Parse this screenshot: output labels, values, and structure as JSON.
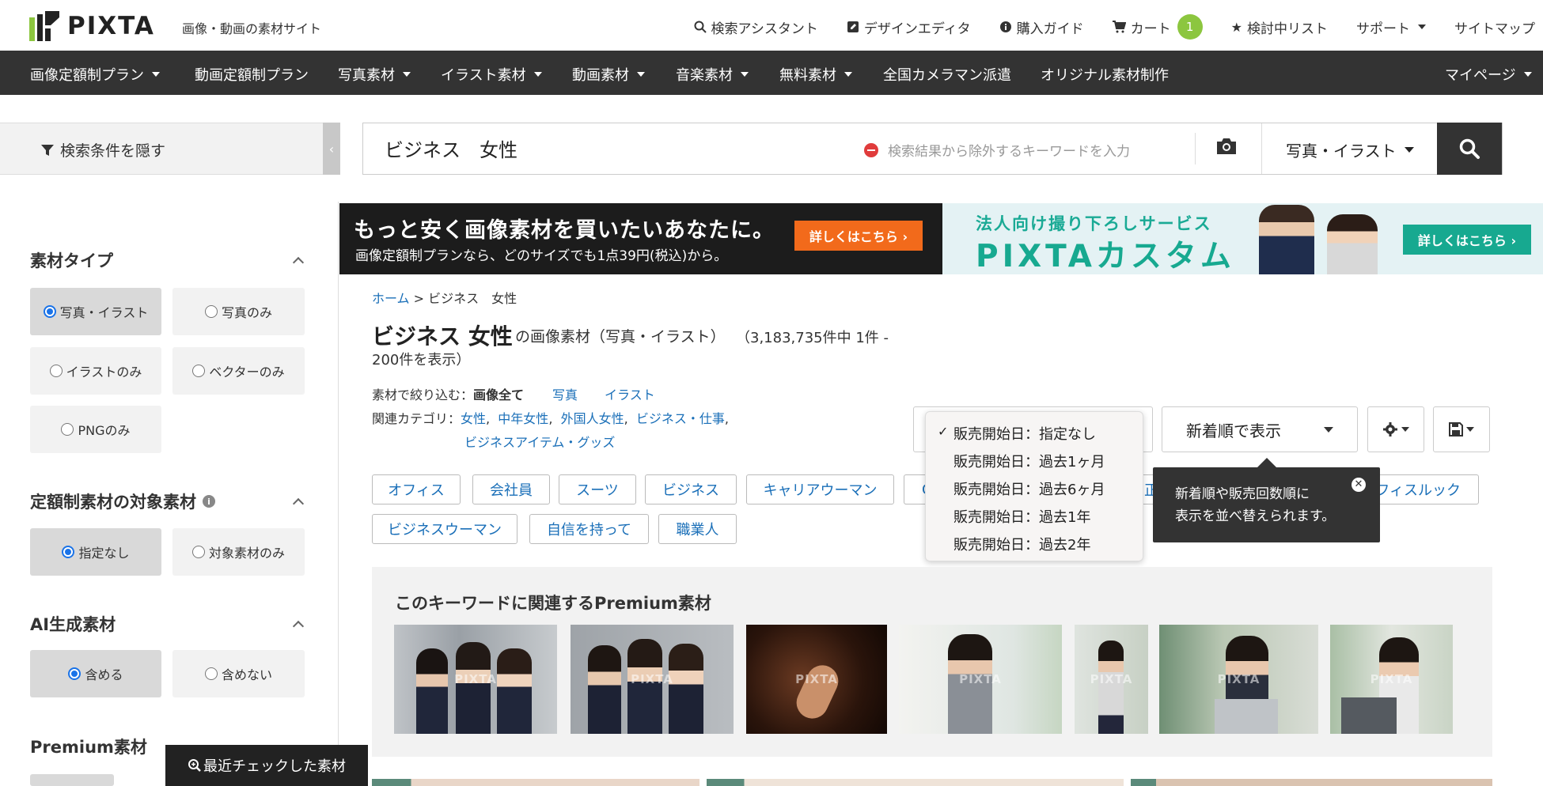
{
  "header": {
    "logo_text": "PIXTA",
    "tagline": "画像・動画の素材サイト",
    "links": {
      "assistant": "検索アシスタント",
      "editor": "デザインエディタ",
      "guide": "購入ガイド",
      "cart": "カート",
      "cart_count": "1",
      "watchlist": "検討中リスト",
      "support": "サポート",
      "sitemap": "サイトマップ"
    }
  },
  "nav": {
    "items": [
      "画像定額制プラン",
      "動画定額制プラン",
      "写真素材",
      "イラスト素材",
      "動画素材",
      "音楽素材",
      "無料素材",
      "全国カメラマン派遣",
      "オリジナル素材制作"
    ],
    "mypage": "マイページ"
  },
  "search": {
    "toggle_label": "検索条件を隠す",
    "query": "ビジネス　女性",
    "exclude_placeholder": "検索結果から除外するキーワードを入力",
    "type_value": "写真・イラスト"
  },
  "sidebar": {
    "material_type": {
      "title": "素材タイプ",
      "options": [
        "写真・イラスト",
        "写真のみ",
        "イラストのみ",
        "ベクターのみ",
        "PNGのみ"
      ]
    },
    "subscription": {
      "title": "定額制素材の対象素材",
      "info": "i",
      "options": [
        "指定なし",
        "対象素材のみ"
      ]
    },
    "ai": {
      "title": "AI生成素材",
      "options": [
        "含める",
        "含めない"
      ]
    },
    "premium": {
      "title": "Premium素材"
    },
    "recent_button": "最近チェックした素材"
  },
  "banners": {
    "left": {
      "headline": "もっと安く画像素材を買いたいあなたに。",
      "sub": "画像定額制プランなら、どのサイズでも1点39円(税込)から。",
      "button": "詳しくはこちら ›"
    },
    "right": {
      "headline": "法人向け撮り下ろしサービス",
      "brand": "PIXTAカスタム",
      "button": "詳しくはこちら ›"
    }
  },
  "main": {
    "breadcrumb_home": "ホーム",
    "breadcrumb_sep": ">",
    "breadcrumb_current": "ビジネス　女性",
    "heading": "ビジネス 女性",
    "heading_suffix": "の画像素材（写真・イラスト）",
    "count_line1": "（3,183,735件中 1件 -",
    "count_line2": "200件を表示）",
    "filter_label": "素材で絞り込む：",
    "filter_current": "画像全て",
    "filter_photo": "写真",
    "filter_illust": "イラスト",
    "related_label": "関連カテゴリ：",
    "related": [
      "女性",
      "中年女性",
      "外国人女性",
      "ビジネス・仕事"
    ],
    "related2": "ビジネスアイテム・グッズ",
    "sort_label": "新着順で表示",
    "tooltip": "新着順や販売回数順に 表示を並べ替えられます。",
    "tooltip_line1": "新着順や販売回数順に",
    "tooltip_line2": "表示を並べ替えられます。",
    "dropdown": {
      "check": "✓",
      "options": [
        "販売開始日：指定なし",
        "販売開始日：過去1ヶ月",
        "販売開始日：過去6ヶ月",
        "販売開始日：過去1年",
        "販売開始日：過去2年"
      ]
    },
    "tags_row1": [
      "オフィス",
      "会社員",
      "スーツ",
      "ビジネス",
      "キャリアウーマン",
      "C",
      "正",
      "フィスルック"
    ],
    "tags_row2": [
      "ビジネスウーマン",
      "自信を持って",
      "職業人"
    ],
    "premium_title": "このキーワードに関連するPremium素材",
    "watermark": "PIXTA"
  },
  "colors": {
    "nav_bg": "#333333",
    "link": "#1a6fb8",
    "cart_badge": "#8cc63f",
    "banner_orange": "#f26a1b",
    "banner_teal": "#17a990"
  }
}
